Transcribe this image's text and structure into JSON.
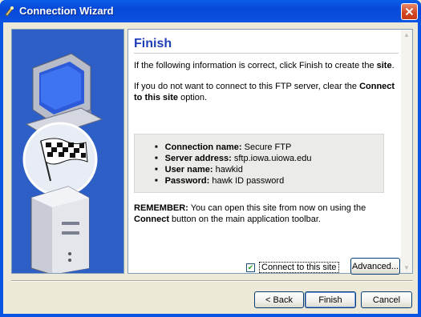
{
  "window": {
    "title": "Connection Wizard",
    "icon": "wizard-icon"
  },
  "page": {
    "heading": "Finish",
    "para1_pre": "If the following information is correct, click Finish to create the ",
    "para1_bold": "site",
    "para1_post": ".",
    "para2_pre": "If you do not want to connect to this FTP server, clear the ",
    "para2_bold": "Connect to this site",
    "para2_post": " option.",
    "summary": [
      {
        "label": "Connection name:",
        "value": "Secure FTP"
      },
      {
        "label": "Server address:",
        "value": "sftp.iowa.uiowa.edu"
      },
      {
        "label": "User name:",
        "value": "hawkid"
      },
      {
        "label": "Password:",
        "value": "hawk ID password"
      }
    ],
    "remember_bold": "REMEMBER:",
    "remember_text": " You can open this site from now on using the ",
    "remember_connect": "Connect",
    "remember_tail": " button on the main application toolbar."
  },
  "controls": {
    "connect_checkbox_label": "Connect to this site",
    "connect_checked": true,
    "advanced_label": "Advanced...",
    "back_label": "< Back",
    "finish_label": "Finish",
    "cancel_label": "Cancel"
  },
  "colors": {
    "title_bar": "#0a54e3",
    "heading": "#1f3fb8",
    "art_panel": "#2e5fc6"
  }
}
